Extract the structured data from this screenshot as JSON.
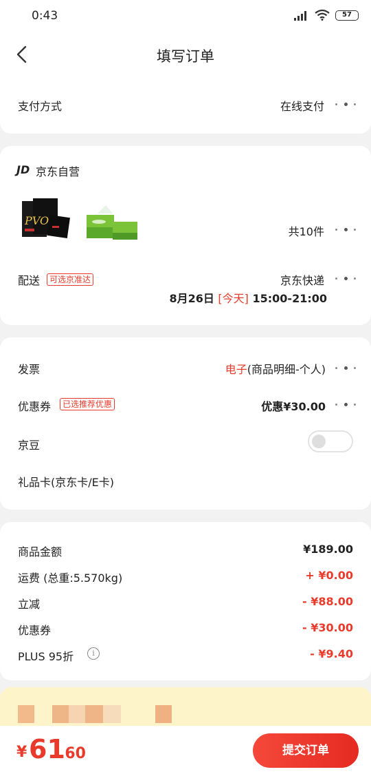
{
  "status_bar": {
    "time": "0:43",
    "battery": "57"
  },
  "header": {
    "title": "填写订单"
  },
  "payment": {
    "label": "支付方式",
    "value": "在线支付"
  },
  "shop": {
    "logo": "JD",
    "name": "京东自营",
    "item_count": "共10件",
    "delivery_label": "配送",
    "delivery_tag": "可选京准达",
    "delivery_method": "京东快递",
    "delivery_date": "8月26日",
    "delivery_today": "[今天]",
    "delivery_time": "15:00-21:00"
  },
  "options": {
    "invoice_label": "发票",
    "invoice_type": "电子",
    "invoice_detail": "(商品明细-个人)",
    "coupon_label": "优惠券",
    "coupon_tag": "已选推荐优惠",
    "coupon_value": "优惠¥30.00",
    "jingdou_label": "京豆",
    "giftcard_label": "礼品卡(京东卡/E卡)"
  },
  "summary": {
    "items": [
      {
        "label": "商品金额",
        "value": "¥189.00",
        "color": "#222222"
      },
      {
        "label": "运费 (总重:5.570kg)",
        "value": "+ ¥0.00",
        "color": "#e93b2b"
      },
      {
        "label": "立减",
        "value": "- ¥88.00",
        "color": "#e93b2b"
      },
      {
        "label": "优惠券",
        "value": "- ¥30.00",
        "color": "#e93b2b"
      },
      {
        "label": "PLUS 95折",
        "value": "- ¥9.40",
        "color": "#e93b2b"
      }
    ]
  },
  "footer": {
    "currency": "¥",
    "price_int": "61",
    "price_dec": ".60",
    "submit_label": "提交订单"
  },
  "colors": {
    "accent": "#e93b2b",
    "background": "#f2f2f2",
    "promo_band": "#fdf4c9"
  }
}
